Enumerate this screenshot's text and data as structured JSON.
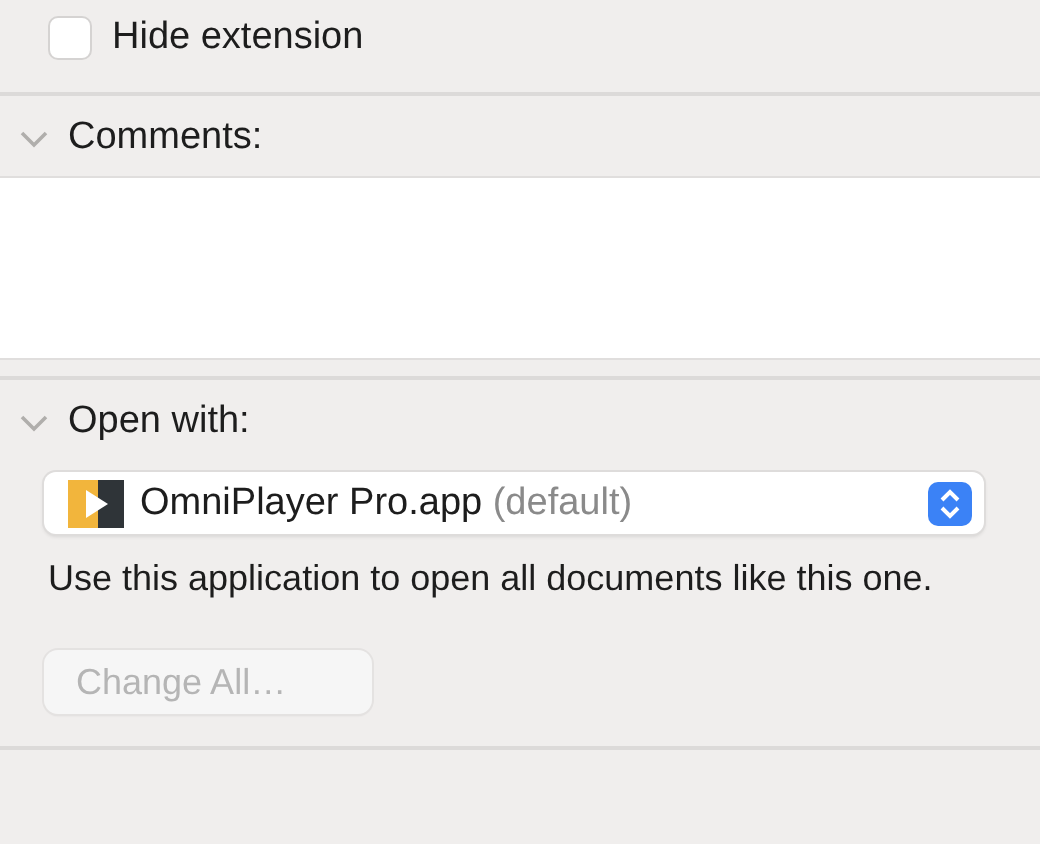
{
  "hide_extension": {
    "label": "Hide extension",
    "checked": false
  },
  "comments": {
    "title": "Comments:",
    "expanded": true
  },
  "open_with": {
    "title": "Open with:",
    "expanded": true,
    "app": {
      "name": "OmniPlayer Pro.app",
      "note": "(default)"
    },
    "description": "Use this application to open all documents like this one.",
    "change_all": {
      "label": "Change All…",
      "disabled": true
    }
  }
}
